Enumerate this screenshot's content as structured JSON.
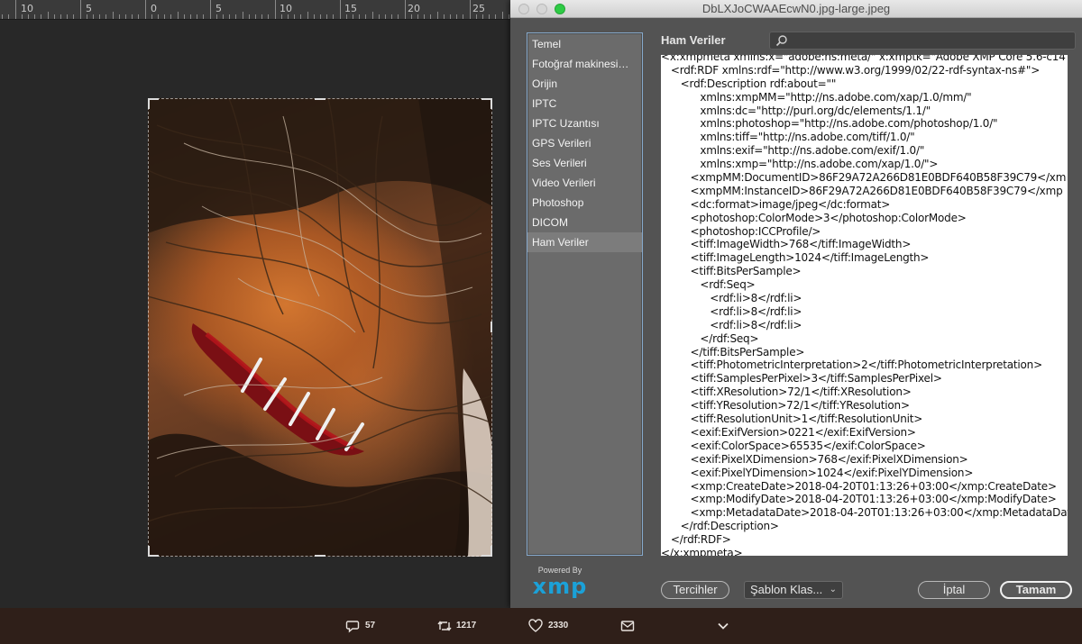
{
  "ruler": {
    "labels": [
      "10",
      "5",
      "0",
      "5",
      "10",
      "15",
      "20",
      "25"
    ]
  },
  "dialog": {
    "window_title": "DbLXJoCWAAEcwN0.jpg-large.jpeg",
    "section_title": "Ham Veriler",
    "search": {
      "placeholder": "",
      "icon": "search-icon"
    },
    "sidebar": {
      "items": [
        {
          "label": "Temel"
        },
        {
          "label": "Fotoğraf makinesi…"
        },
        {
          "label": "Orijin"
        },
        {
          "label": "IPTC"
        },
        {
          "label": "IPTC Uzantısı"
        },
        {
          "label": "GPS Verileri"
        },
        {
          "label": "Ses Verileri"
        },
        {
          "label": "Video Verileri"
        },
        {
          "label": "Photoshop"
        },
        {
          "label": "DICOM"
        },
        {
          "label": "Ham Veriler"
        }
      ],
      "active_index": 10
    },
    "xml_lines": [
      "<x:xmpmeta xmlns:x=\"adobe:ns:meta/\" x:xmptk=\"Adobe XMP Core 5.6-c14",
      "   <rdf:RDF xmlns:rdf=\"http://www.w3.org/1999/02/22-rdf-syntax-ns#\">",
      "      <rdf:Description rdf:about=\"\"",
      "            xmlns:xmpMM=\"http://ns.adobe.com/xap/1.0/mm/\"",
      "            xmlns:dc=\"http://purl.org/dc/elements/1.1/\"",
      "            xmlns:photoshop=\"http://ns.adobe.com/photoshop/1.0/\"",
      "            xmlns:tiff=\"http://ns.adobe.com/tiff/1.0/\"",
      "            xmlns:exif=\"http://ns.adobe.com/exif/1.0/\"",
      "            xmlns:xmp=\"http://ns.adobe.com/xap/1.0/\">",
      "         <xmpMM:DocumentID>86F29A72A266D81E0BDF640B58F39C79</xm",
      "         <xmpMM:InstanceID>86F29A72A266D81E0BDF640B58F39C79</xmp",
      "         <dc:format>image/jpeg</dc:format>",
      "         <photoshop:ColorMode>3</photoshop:ColorMode>",
      "         <photoshop:ICCProfile/>",
      "         <tiff:ImageWidth>768</tiff:ImageWidth>",
      "         <tiff:ImageLength>1024</tiff:ImageLength>",
      "         <tiff:BitsPerSample>",
      "            <rdf:Seq>",
      "               <rdf:li>8</rdf:li>",
      "               <rdf:li>8</rdf:li>",
      "               <rdf:li>8</rdf:li>",
      "            </rdf:Seq>",
      "         </tiff:BitsPerSample>",
      "         <tiff:PhotometricInterpretation>2</tiff:PhotometricInterpretation>",
      "         <tiff:SamplesPerPixel>3</tiff:SamplesPerPixel>",
      "         <tiff:XResolution>72/1</tiff:XResolution>",
      "         <tiff:YResolution>72/1</tiff:YResolution>",
      "         <tiff:ResolutionUnit>1</tiff:ResolutionUnit>",
      "         <exif:ExifVersion>0221</exif:ExifVersion>",
      "         <exif:ColorSpace>65535</exif:ColorSpace>",
      "         <exif:PixelXDimension>768</exif:PixelXDimension>",
      "         <exif:PixelYDimension>1024</exif:PixelYDimension>",
      "         <xmp:CreateDate>2018-04-20T01:13:26+03:00</xmp:CreateDate>",
      "         <xmp:ModifyDate>2018-04-20T01:13:26+03:00</xmp:ModifyDate>",
      "         <xmp:MetadataDate>2018-04-20T01:13:26+03:00</xmp:MetadataDat",
      "      </rdf:Description>",
      "   </rdf:RDF>",
      "</x:xmpmeta>"
    ],
    "logo": {
      "powered_by": "Powered By",
      "brand": "xmp"
    },
    "buttons": {
      "preferences": "Tercihler",
      "template": "Şablon Klas...",
      "cancel": "İptal",
      "ok": "Tamam"
    }
  },
  "tweet": {
    "reply_count": "57",
    "retweet_count": "1217",
    "like_count": "2330",
    "icons": [
      "reply-icon",
      "retweet-icon",
      "like-icon",
      "message-icon",
      "chevron-down-icon"
    ]
  },
  "colors": {
    "dialog_bg": "#535353",
    "sidebar_border": "#86a9cc",
    "xmp_blue": "#1ba1d8",
    "tweet_bar": "#2f1f19"
  }
}
